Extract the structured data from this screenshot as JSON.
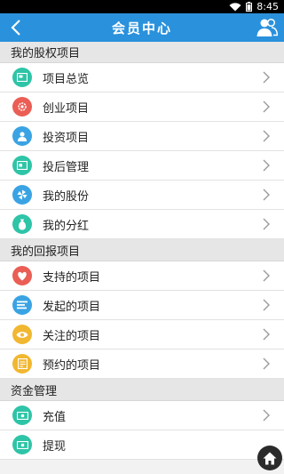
{
  "status_bar": {
    "time": "8:45"
  },
  "header": {
    "title": "会员中心"
  },
  "sections": [
    {
      "title": "我的股权项目",
      "items": [
        {
          "label": "项目总览",
          "icon": "project-overview-icon",
          "color": "#2ec4a7"
        },
        {
          "label": "创业项目",
          "icon": "gear-icon",
          "color": "#ea5e55"
        },
        {
          "label": "投资项目",
          "icon": "person-icon",
          "color": "#3aa3e3"
        },
        {
          "label": "投后管理",
          "icon": "management-icon",
          "color": "#2ec4a7"
        },
        {
          "label": "我的股份",
          "icon": "pinwheel-icon",
          "color": "#3aa3e3"
        },
        {
          "label": "我的分红",
          "icon": "money-bag-icon",
          "color": "#2ec4a7"
        }
      ]
    },
    {
      "title": "我的回报项目",
      "items": [
        {
          "label": "支持的项目",
          "icon": "heart-icon",
          "color": "#ea5e55"
        },
        {
          "label": "发起的项目",
          "icon": "list-icon",
          "color": "#3aa3e3"
        },
        {
          "label": "关注的项目",
          "icon": "eye-icon",
          "color": "#f1b731"
        },
        {
          "label": "预约的项目",
          "icon": "note-icon",
          "color": "#f1b731"
        }
      ]
    },
    {
      "title": "资金管理",
      "items": [
        {
          "label": "充值",
          "icon": "recharge-icon",
          "color": "#2ec4a7"
        },
        {
          "label": "提现",
          "icon": "withdraw-icon",
          "color": "#2ec4a7"
        }
      ]
    }
  ]
}
